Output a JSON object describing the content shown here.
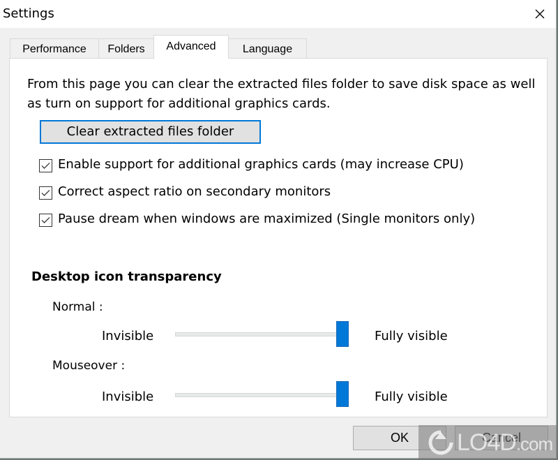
{
  "window": {
    "title": "Settings",
    "close_icon": "close-icon"
  },
  "tabs": [
    {
      "label": "Performance",
      "active": false
    },
    {
      "label": "Folders",
      "active": false
    },
    {
      "label": "Advanced",
      "active": true
    },
    {
      "label": "Language",
      "active": false
    }
  ],
  "advanced": {
    "description": "From this page you can clear the extracted files folder to save disk space as well as turn on support for additional graphics cards.",
    "clear_button": "Clear extracted files folder",
    "checkboxes": [
      {
        "label": "Enable support for additional graphics cards (may increase CPU)",
        "checked": true
      },
      {
        "label": "Correct aspect ratio on secondary monitors",
        "checked": true
      },
      {
        "label": "Pause dream when windows are maximized (Single monitors only)",
        "checked": true
      }
    ],
    "transparency": {
      "title": "Desktop icon transparency",
      "sliders": [
        {
          "label": "Normal :",
          "min_label": "Invisible",
          "max_label": "Fully visible",
          "value_percent": 100
        },
        {
          "label": "Mouseover :",
          "min_label": "Invisible",
          "max_label": "Fully visible",
          "value_percent": 100
        }
      ]
    }
  },
  "footer": {
    "ok": "OK",
    "cancel": "Cancel"
  },
  "watermark": {
    "text": "LO4D",
    "suffix": ".com"
  },
  "colors": {
    "accent": "#0078d7"
  }
}
